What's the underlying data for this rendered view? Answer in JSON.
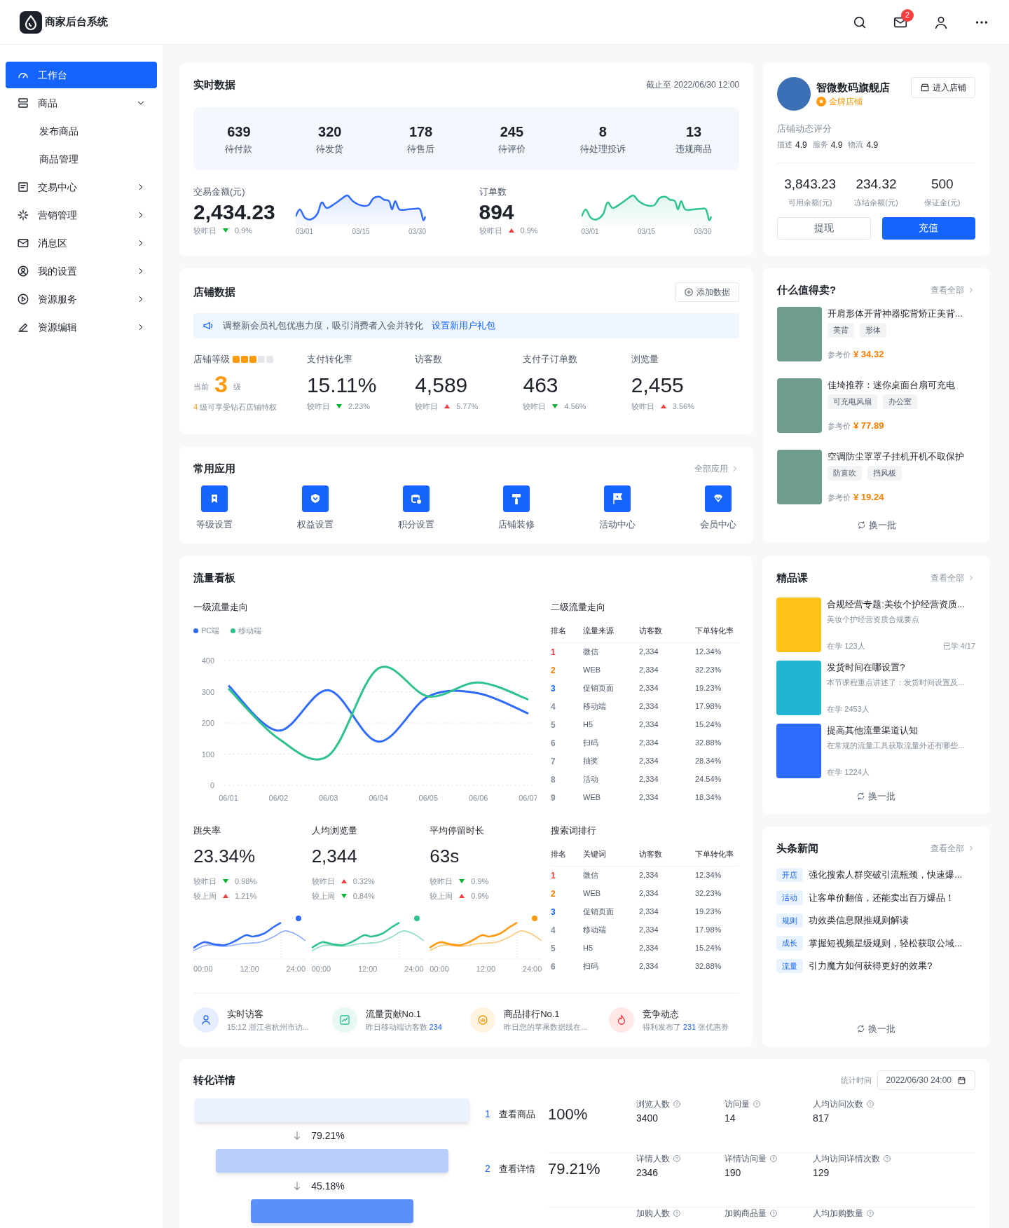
{
  "header": {
    "title": "商家后台系统",
    "mail_badge": "2"
  },
  "sidebar": {
    "items": [
      {
        "label": "工作台",
        "kind": "page",
        "selected": true
      },
      {
        "label": "商品",
        "kind": "group",
        "selected": false,
        "expanded": true,
        "children": [
          {
            "label": "发布商品",
            "selected": false
          },
          {
            "label": "商品管理",
            "selected": false
          }
        ]
      },
      {
        "label": "交易中心",
        "kind": "group",
        "selected": false,
        "expanded": false
      },
      {
        "label": "营销管理",
        "kind": "group",
        "selected": false,
        "expanded": false
      },
      {
        "label": "消息区",
        "kind": "group",
        "selected": false,
        "expanded": false
      },
      {
        "label": "我的设置",
        "kind": "group",
        "selected": false,
        "expanded": false
      },
      {
        "label": "资源服务",
        "kind": "group",
        "selected": false,
        "expanded": false
      },
      {
        "label": "资源编辑",
        "kind": "group",
        "selected": false,
        "expanded": false
      }
    ]
  },
  "realtime": {
    "title": "实时数据",
    "updated": "截止至 2022/06/30 12:00",
    "counters": [
      {
        "value": "639",
        "label": "待付款"
      },
      {
        "value": "320",
        "label": "待发货"
      },
      {
        "value": "178",
        "label": "待售后"
      },
      {
        "value": "245",
        "label": "待评价"
      },
      {
        "value": "8",
        "label": "待处理投诉"
      },
      {
        "value": "13",
        "label": "违规商品"
      }
    ],
    "kpis": [
      {
        "label": "交易金额(元)",
        "value": "2,434.23",
        "compare_label": "较昨日",
        "rising": false,
        "change": "0.9%",
        "color": "#2f6bff",
        "xticks": [
          "03/01",
          "03/15",
          "03/30"
        ]
      },
      {
        "label": "订单数",
        "value": "894",
        "compare_label": "较昨日",
        "rising": true,
        "change": "0.9%",
        "color": "#2fc38c",
        "xticks": [
          "03/01",
          "03/15",
          "03/30"
        ]
      }
    ]
  },
  "store": {
    "title": "店铺数据",
    "add_button": "添加数据",
    "notice": {
      "text": "调整新会员礼包优惠力度，吸引消费者入会并转化",
      "link": "设置新用户礼包"
    },
    "level": {
      "label": "店铺等级",
      "stars": 3,
      "prefix": "当前",
      "value": "3",
      "suffix": "级",
      "next_level": "4",
      "hint": "级可享受钻石店铺特权"
    },
    "metrics": [
      {
        "label": "支付转化率",
        "value": "15.11%",
        "compare_label": "较昨日",
        "rising": false,
        "change": "2.23%"
      },
      {
        "label": "访客数",
        "value": "4,589",
        "compare_label": "较昨日",
        "rising": true,
        "change": "5.77%"
      },
      {
        "label": "支付子订单数",
        "value": "463",
        "compare_label": "较昨日",
        "rising": false,
        "change": "4.56%"
      },
      {
        "label": "浏览量",
        "value": "2,455",
        "compare_label": "较昨日",
        "rising": true,
        "change": "3.56%"
      }
    ]
  },
  "apps": {
    "title": "常用应用",
    "more": "全部应用",
    "items": [
      {
        "label": "等级设置"
      },
      {
        "label": "权益设置"
      },
      {
        "label": "积分设置"
      },
      {
        "label": "店铺装修"
      },
      {
        "label": "活动中心"
      },
      {
        "label": "会员中心"
      }
    ]
  },
  "traffic": {
    "title": "流量看板",
    "primary": {
      "title": "一级流量走向",
      "chart_data": {
        "type": "line",
        "categories": [
          "06/01",
          "06/02",
          "06/03",
          "06/04",
          "06/05",
          "06/06",
          "06/07"
        ],
        "series": [
          {
            "name": "PC端",
            "color": "#2f6bff",
            "values": [
              320,
              175,
              305,
              140,
              285,
              295,
              230
            ]
          },
          {
            "name": "移动端",
            "color": "#2fc38c",
            "values": [
              310,
              150,
              95,
              375,
              285,
              330,
              275
            ]
          }
        ],
        "ylim": [
          0,
          400
        ],
        "yticks": [
          0,
          100,
          200,
          300,
          400
        ],
        "grid": true
      }
    },
    "secondary": {
      "title": "二级流量走向",
      "columns": [
        "排名",
        "流量来源",
        "访客数",
        "下单转化率"
      ],
      "rows": [
        {
          "rank": "1",
          "color": "#f53f3f",
          "source": "微信",
          "visitors": "2,334",
          "rate": "12.34%"
        },
        {
          "rank": "2",
          "color": "#ff7d00",
          "source": "WEB",
          "visitors": "2,334",
          "rate": "32.23%"
        },
        {
          "rank": "3",
          "color": "#1664ff",
          "source": "促销页面",
          "visitors": "2,334",
          "rate": "19.23%"
        },
        {
          "rank": "4",
          "color": "#86909c",
          "source": "移动端",
          "visitors": "2,334",
          "rate": "17.98%"
        },
        {
          "rank": "5",
          "color": "#86909c",
          "source": "H5",
          "visitors": "2,334",
          "rate": "15.24%"
        },
        {
          "rank": "6",
          "color": "#86909c",
          "source": "扫码",
          "visitors": "2,334",
          "rate": "32.88%"
        },
        {
          "rank": "7",
          "color": "#86909c",
          "source": "抽奖",
          "visitors": "2,334",
          "rate": "28.34%"
        },
        {
          "rank": "8",
          "color": "#86909c",
          "source": "活动",
          "visitors": "2,334",
          "rate": "24.54%"
        },
        {
          "rank": "9",
          "color": "#86909c",
          "source": "WEB",
          "visitors": "2,334",
          "rate": "18.34%"
        }
      ]
    },
    "stats": [
      {
        "label": "跳失率",
        "value": "23.34%",
        "color": "#2f6bff",
        "comparisons": [
          {
            "label": "较昨日",
            "rising": false,
            "change": "0.98%"
          },
          {
            "label": "较上周",
            "rising": true,
            "change": "1.21%"
          }
        ],
        "xticks": [
          "00:00",
          "12:00",
          "24:00"
        ]
      },
      {
        "label": "人均浏览量",
        "value": "2,344",
        "color": "#2fc38c",
        "comparisons": [
          {
            "label": "较昨日",
            "rising": true,
            "change": "0.32%"
          },
          {
            "label": "较上周",
            "rising": false,
            "change": "0.84%"
          }
        ],
        "xticks": [
          "00:00",
          "12:00",
          "24:00"
        ]
      },
      {
        "label": "平均停留时长",
        "value": "63s",
        "color": "#ff9a0e",
        "comparisons": [
          {
            "label": "较昨日",
            "rising": false,
            "change": "0.9%"
          },
          {
            "label": "较上周",
            "rising": true,
            "change": "0.9%"
          }
        ],
        "xticks": [
          "00:00",
          "12:00",
          "24:00"
        ]
      }
    ],
    "search": {
      "title": "搜索词排行",
      "columns": [
        "排名",
        "关键词",
        "访客数",
        "下单转化率"
      ],
      "rows": [
        {
          "rank": "1",
          "color": "#f53f3f",
          "keyword": "微信",
          "visitors": "2,334",
          "rate": "12.34%"
        },
        {
          "rank": "2",
          "color": "#ff7d00",
          "keyword": "WEB",
          "visitors": "2,334",
          "rate": "32.23%"
        },
        {
          "rank": "3",
          "color": "#1664ff",
          "keyword": "促销页面",
          "visitors": "2,334",
          "rate": "19.23%"
        },
        {
          "rank": "4",
          "color": "#86909c",
          "keyword": "移动端",
          "visitors": "2,334",
          "rate": "17.98%"
        },
        {
          "rank": "5",
          "color": "#86909c",
          "keyword": "H5",
          "visitors": "2,334",
          "rate": "15.24%"
        },
        {
          "rank": "6",
          "color": "#86909c",
          "keyword": "扫码",
          "visitors": "2,334",
          "rate": "32.88%"
        }
      ]
    },
    "highlights": [
      {
        "title": "实时访客",
        "text": "15:12  浙江省杭州市访...",
        "color": "#2f6bff"
      },
      {
        "title": "流量贡献No.1",
        "text": "昨日移动端访客数",
        "number": "234",
        "color": "#2fc38c"
      },
      {
        "title": "商品排行No.1",
        "text": "昨日您的苹果数据线在...",
        "color": "#ff9a0e"
      },
      {
        "title": "竞争动态",
        "text": "得利发布了",
        "number": "231",
        "text_after": "张优惠券",
        "color": "#f53f3f"
      }
    ]
  },
  "conversion": {
    "title": "转化详情",
    "time_label": "统计时间",
    "time_value": "2022/06/30 24:00",
    "drops": [
      "79.21%",
      "45.18%"
    ],
    "steps": [
      {
        "index": "1",
        "label": "查看商品",
        "rate": "100%",
        "metrics": [
          {
            "label": "浏览人数",
            "value": "3400"
          },
          {
            "label": "访问量",
            "value": "14"
          },
          {
            "label": "人均访问次数",
            "value": "817"
          }
        ]
      },
      {
        "index": "2",
        "label": "查看详情",
        "rate": "79.21%",
        "metrics": [
          {
            "label": "详情人数",
            "value": "2346"
          },
          {
            "label": "详情访问量",
            "value": "190"
          },
          {
            "label": "人均访问详情次数",
            "value": "129"
          }
        ]
      },
      {
        "metrics": [
          {
            "label": "加购人数"
          },
          {
            "label": "加购商品量"
          },
          {
            "label": "人均加购数量"
          }
        ]
      }
    ]
  },
  "shop": {
    "name": "智微数码旗舰店",
    "badge": "金牌店铺",
    "enter_button": "进入店铺",
    "rating_title": "店铺动态评分",
    "ratings": [
      {
        "label": "描述",
        "value": "4.9"
      },
      {
        "label": "服务",
        "value": "4.9"
      },
      {
        "label": "物流",
        "value": "4.9"
      }
    ],
    "balances": [
      {
        "value": "3,843.23",
        "label": "可用余额(元)"
      },
      {
        "value": "234.32",
        "label": "冻结余额(元)"
      },
      {
        "value": "500",
        "label": "保证金(元)"
      }
    ],
    "buttons": [
      {
        "label": "提现",
        "kind": "secondary"
      },
      {
        "label": "充值",
        "kind": "primary"
      }
    ]
  },
  "hot": {
    "title": "什么值得卖?",
    "more": "查看全部",
    "refresh": "换一批",
    "items": [
      {
        "title": "开肩形体开背神器驼背矫正美背...",
        "tags": [
          "美背",
          "形体"
        ],
        "price_label": "参考价",
        "price": "¥ 34.32"
      },
      {
        "title": "佳埼推荐：迷你桌面台扇可充电",
        "tags": [
          "可充电风扇",
          "办公室"
        ],
        "price_label": "参考价",
        "price": "¥ 77.89"
      },
      {
        "title": "空调防尘罩罩子挂机开机不取保护",
        "tags": [
          "防直吹",
          "挡风板"
        ],
        "price_label": "参考价",
        "price": "¥ 19.24"
      }
    ]
  },
  "courses": {
    "title": "精品课",
    "more": "查看全部",
    "refresh": "换一批",
    "items": [
      {
        "title": "合规经营专题:美妆个护经营资质...",
        "desc": "美妆个护经营资质合规要点",
        "learners": "在学 123人",
        "studied": "已学 4/17",
        "color": "#ffc21a"
      },
      {
        "title": "发货时间在哪设置?",
        "desc": "本节课程重点讲述了：发货时间设置及...",
        "learners": "在学 2453人",
        "color": "#22b5d3"
      },
      {
        "title": "提高其他流量渠道认知",
        "desc": "在常规的流量工具获取流量外还有哪些...",
        "learners": "在学 1224人",
        "color": "#2f6bff"
      }
    ]
  },
  "news": {
    "title": "头条新闻",
    "more": "查看全部",
    "refresh": "换一批",
    "items": [
      {
        "tag": "开店",
        "title": "强化搜索人群突破引流瓶颈，快速爆..."
      },
      {
        "tag": "活动",
        "title": "让客单价翻倍，还能卖出百万爆品！"
      },
      {
        "tag": "规则",
        "title": "功效类信息限推规则解读"
      },
      {
        "tag": "成长",
        "title": "掌握短视频星级规则，轻松获取公域..."
      },
      {
        "tag": "流量",
        "title": "引力魔方如何获得更好的效果?"
      }
    ]
  }
}
